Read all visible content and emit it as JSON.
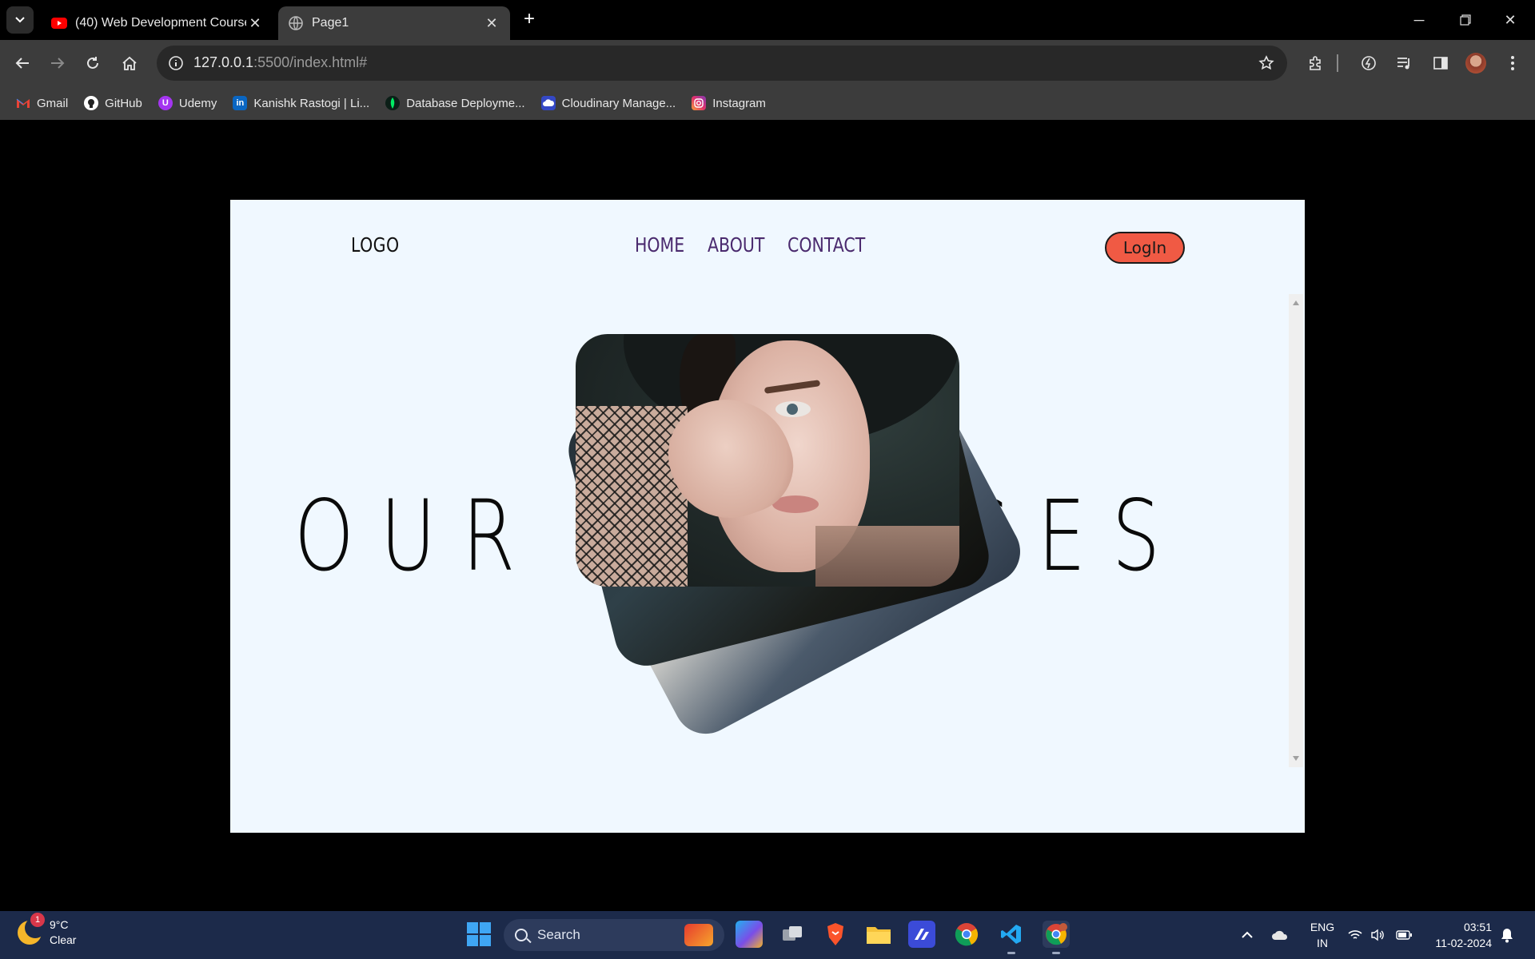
{
  "browser": {
    "tabs": [
      {
        "title": "(40) Web Development Course |",
        "active": false,
        "favicon": "youtube-icon"
      },
      {
        "title": "Page1",
        "active": true,
        "favicon": "globe-icon"
      }
    ],
    "url_host": "127.0.0.1",
    "url_rest": ":5500/index.html#",
    "bookmarks": [
      {
        "label": "Gmail",
        "icon": "gmail-icon",
        "color": "#ea4335"
      },
      {
        "label": "GitHub",
        "icon": "github-icon",
        "color": "#ffffff"
      },
      {
        "label": "Udemy",
        "icon": "udemy-icon",
        "color": "#a435f0"
      },
      {
        "label": "Kanishk Rastogi | Li...",
        "icon": "linkedin-icon",
        "color": "#0a66c2"
      },
      {
        "label": "Database Deployme...",
        "icon": "mongodb-icon",
        "color": "#00ed64"
      },
      {
        "label": "Cloudinary Manage...",
        "icon": "cloudinary-icon",
        "color": "#3448c5"
      },
      {
        "label": "Instagram",
        "icon": "instagram-icon",
        "color": "#e1306c"
      }
    ]
  },
  "page": {
    "logo": "LOGO",
    "nav": [
      "HOME",
      "ABOUT",
      "CONTACT"
    ],
    "login": "LogIn",
    "hero_left": "OUR A",
    "hero_right": "AGES",
    "accent": "#f05a44",
    "background": "#f0f8ff"
  },
  "taskbar": {
    "weather_temp": "9°C",
    "weather_desc": "Clear",
    "weather_badge": "1",
    "search_placeholder": "Search",
    "lang_1": "ENG",
    "lang_2": "IN",
    "time": "03:51",
    "date": "11-02-2024"
  }
}
